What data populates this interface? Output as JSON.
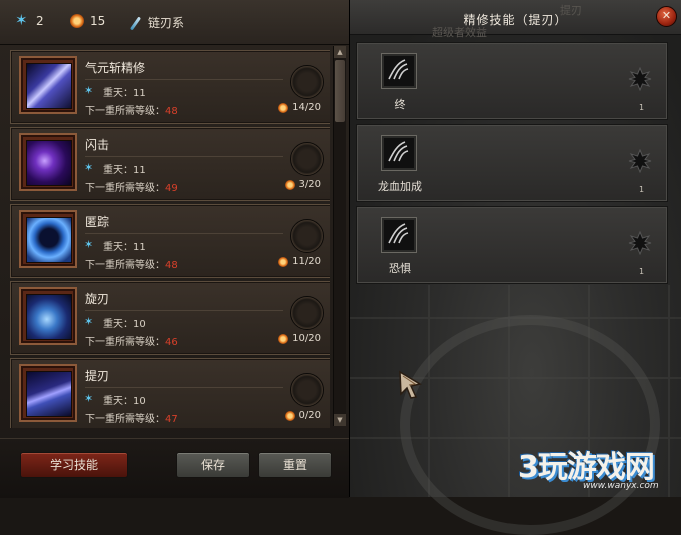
{
  "topbar": {
    "star_points": "2",
    "sun_points": "15",
    "skill_tree": "链刃系"
  },
  "skills": [
    {
      "name": "气元斩精修",
      "tier_label": "重天：11",
      "req_label": "下一重所需等级：",
      "req_level": "48",
      "progress": "14/20",
      "icon": "sword-slash-icon",
      "icon_color": "#6a6ad8"
    },
    {
      "name": "闪击",
      "tier_label": "重天：11",
      "req_label": "下一重所需等级：",
      "req_level": "49",
      "progress": "3/20",
      "icon": "shadow-strike-icon",
      "icon_color": "#7030c0"
    },
    {
      "name": "匿踪",
      "tier_label": "重天：11",
      "req_label": "下一重所需等级：",
      "req_level": "48",
      "progress": "11/20",
      "icon": "stealth-icon",
      "icon_color": "#2a6ac8"
    },
    {
      "name": "旋刃",
      "tier_label": "重天：10",
      "req_label": "下一重所需等级：",
      "req_level": "46",
      "progress": "10/20",
      "icon": "spin-blade-icon",
      "icon_color": "#3a78c8"
    },
    {
      "name": "提刃",
      "tier_label": "重天：10",
      "req_label": "下一重所需等级：",
      "req_level": "47",
      "progress": "0/20",
      "icon": "raise-blade-icon",
      "icon_color": "#4050b8"
    }
  ],
  "buttons": {
    "learn": "学习技能",
    "save": "保存",
    "reset": "重置"
  },
  "refine_panel": {
    "title": "精修技能（提刃）",
    "close_symbol": "✕",
    "ghost_top": "提刃",
    "ghost_sub": "超级者效益",
    "items": [
      {
        "label": "终",
        "count": "1"
      },
      {
        "label": "龙血加成",
        "count": "1"
      },
      {
        "label": "恐惧",
        "count": "1"
      }
    ]
  },
  "watermark": {
    "text": "3玩游戏网",
    "url": "www.wanyx.com"
  },
  "colors": {
    "accent_red": "#d8402a",
    "star_blue": "#5fc6ee",
    "sun_orange": "#e0741c"
  }
}
